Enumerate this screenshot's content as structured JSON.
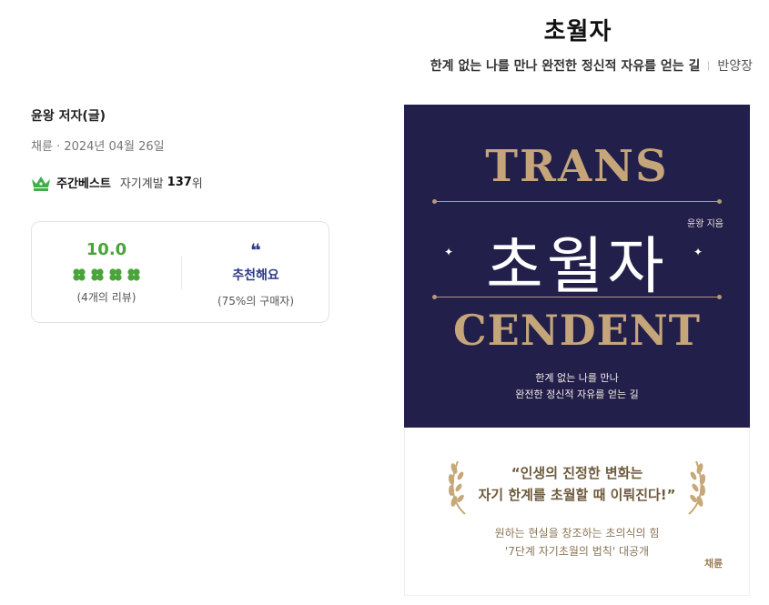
{
  "book": {
    "title": "초월자",
    "subtitle": "한계 없는 나를 만나 완전한 정신적 자유를 얻는 길",
    "translator": "반양장",
    "author": "윤왕 저자(글)",
    "pub_info": "채륜 · 2024년 04월 26일"
  },
  "bestseller": {
    "label": "주간베스트",
    "category": "자기계발",
    "rank": "137",
    "unit": "위"
  },
  "review": {
    "score": "10.0",
    "clover_count": 4,
    "review_note": "(4개의 리뷰)",
    "quote_icon": "quote-icon",
    "recommend_label": "추천해요",
    "recommend_note": "(75%의 구매자)"
  },
  "cover": {
    "word_top": "TRANS",
    "word_bottom": "CENDENT",
    "main_title": "초월자",
    "author_line": "윤왕 지음",
    "sub_line1": "한계 없는 나를 만나",
    "sub_line2": "완전한 정신적 자유를 얻는 길",
    "quote_line1": "“인생의 진정한 변화는",
    "quote_line2": "자기 한계를 초월할 때 이뤄진다!”",
    "desc_line1": "원하는 현실을 창조하는 초의식의 힘",
    "desc_line2": "'7단계 자기초월의 법칙' 대공개",
    "publisher": "채륜"
  },
  "colors": {
    "score_green": "#4aa43a",
    "recommend_blue": "#2c3a8a",
    "cover_navy": "#231f4b",
    "cover_gold": "#c5a57a"
  }
}
